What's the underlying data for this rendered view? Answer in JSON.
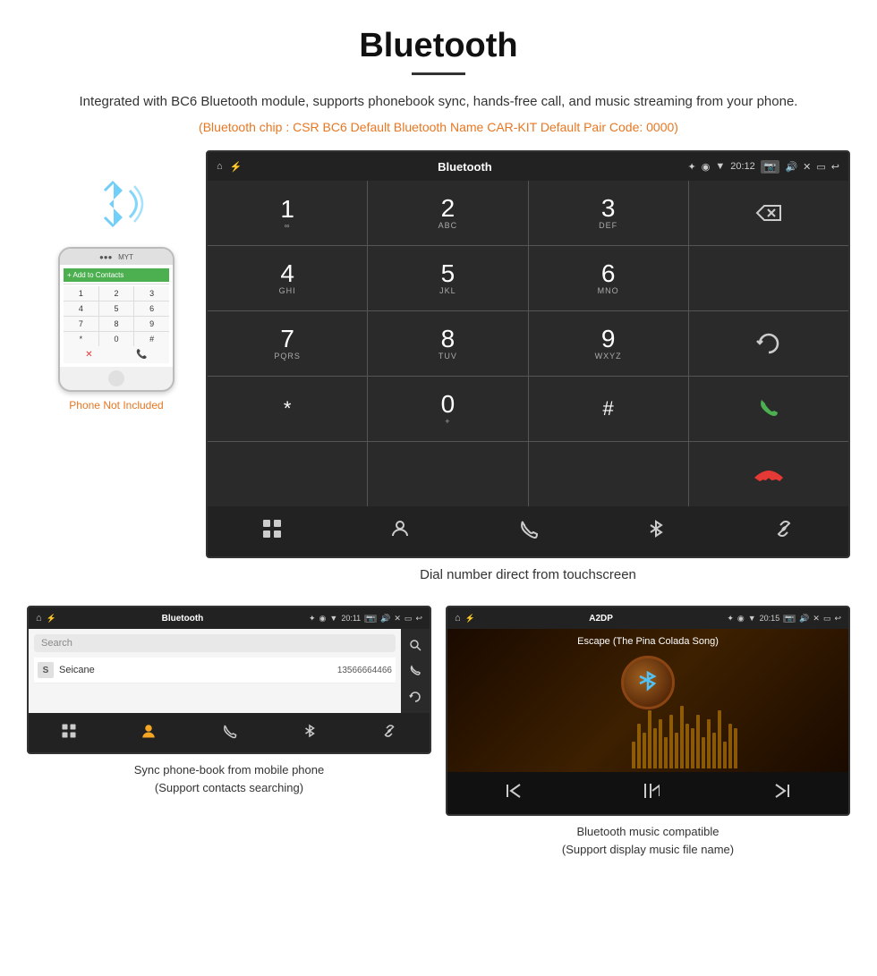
{
  "page": {
    "title": "Bluetooth",
    "subtitle": "Integrated with BC6 Bluetooth module, supports phonebook sync, hands-free call, and music streaming from your phone.",
    "orange_info": "(Bluetooth chip : CSR BC6     Default Bluetooth Name CAR-KIT     Default Pair Code: 0000)"
  },
  "main_screen": {
    "status_bar": {
      "app_name": "Bluetooth",
      "time": "20:12"
    },
    "dialpad": {
      "keys": [
        {
          "num": "1",
          "letters": "∞"
        },
        {
          "num": "2",
          "letters": "ABC"
        },
        {
          "num": "3",
          "letters": "DEF"
        },
        {
          "num": "4",
          "letters": "GHI"
        },
        {
          "num": "5",
          "letters": "JKL"
        },
        {
          "num": "6",
          "letters": "MNO"
        },
        {
          "num": "7",
          "letters": "PQRS"
        },
        {
          "num": "8",
          "letters": "TUV"
        },
        {
          "num": "9",
          "letters": "WXYZ"
        },
        {
          "num": "*",
          "letters": ""
        },
        {
          "num": "0",
          "letters": "+"
        },
        {
          "num": "#",
          "letters": ""
        }
      ]
    },
    "caption": "Dial number direct from touchscreen",
    "toolbar_icons": [
      "grid-icon",
      "person-icon",
      "phone-icon",
      "bluetooth-icon",
      "link-icon"
    ]
  },
  "bottom_left_screen": {
    "status_bar": {
      "app_name": "Bluetooth",
      "time": "20:11"
    },
    "search_placeholder": "Search",
    "contacts": [
      {
        "letter": "S",
        "name": "Seicane",
        "number": "13566664466"
      }
    ],
    "caption": "Sync phone-book from mobile phone\n(Support contacts searching)"
  },
  "bottom_right_screen": {
    "status_bar": {
      "app_name": "A2DP",
      "time": "20:15"
    },
    "song_title": "Escape (The Pina Colada Song)",
    "caption": "Bluetooth music compatible\n(Support display music file name)"
  },
  "phone_mockup": {
    "not_included": "Phone Not Included",
    "keys": [
      "1",
      "2",
      "3",
      "4",
      "5",
      "6",
      "7",
      "8",
      "9",
      "*",
      "0",
      "#"
    ]
  },
  "colors": {
    "orange": "#e87722",
    "green_call": "#4caf50",
    "red_call": "#e53935",
    "screen_bg": "#1a1a1a",
    "screen_border": "#333"
  }
}
